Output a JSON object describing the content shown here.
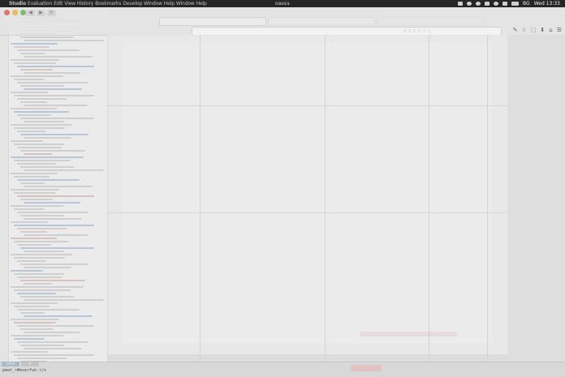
{
  "menubar": {
    "apple_glyph": "",
    "menus": [
      {
        "label": "Studio",
        "bold": true
      },
      {
        "label": "Evaluation",
        "bold": false
      },
      {
        "label": "Edit",
        "bold": false
      },
      {
        "label": "View",
        "bold": false
      },
      {
        "label": "History",
        "bold": false
      },
      {
        "label": "Bookmarks",
        "bold": false
      },
      {
        "label": "Develop",
        "bold": false
      },
      {
        "label": "Window",
        "bold": false
      },
      {
        "label": "Help",
        "bold": false
      },
      {
        "label": "Window",
        "bold": false
      },
      {
        "label": "Help",
        "bold": false
      }
    ],
    "center_title": "oauss",
    "status_icons": [
      "dropbox-icon",
      "cloud-icon",
      "sync-icon",
      "bluetooth-icon",
      "wifi-icon",
      "volume-icon",
      "battery-icon"
    ],
    "input_source": "BG",
    "clock": "Wed 13:33"
  },
  "browser": {
    "nav": [
      "◀",
      "▶",
      "⟳"
    ],
    "url_hint": "⬚ ⬚ ⬚ ⬚ ⬚ ⬚",
    "toolbar_icons": [
      "✎",
      "☆",
      "⬚",
      "⬇",
      "⌂",
      "☰"
    ]
  },
  "bottom": {
    "tab_a": "Shell",
    "tab_b": "R",
    "terminal_text": "pmat_r#exerfun.r/s"
  }
}
